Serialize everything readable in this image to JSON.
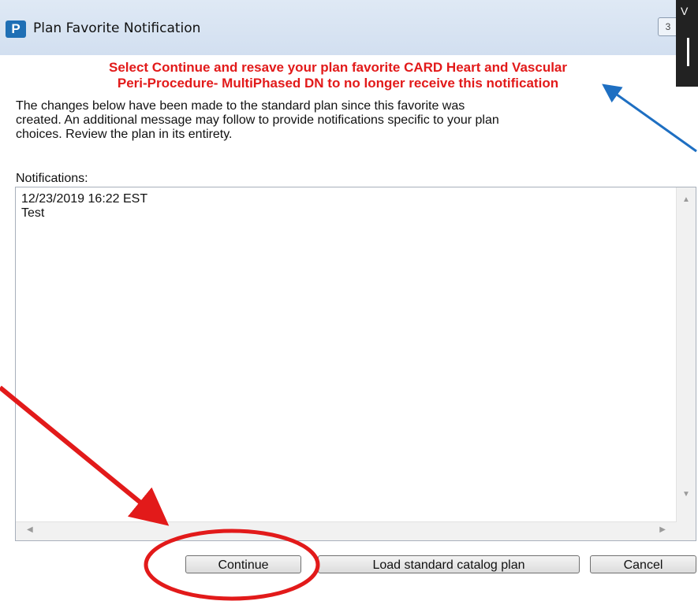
{
  "window": {
    "title": "Plan Favorite Notification",
    "icon_letter": "P",
    "titlebar_button_glyph": "3",
    "edge_glyph": "V"
  },
  "message": {
    "red_line_1": "Select Continue and resave your plan favorite CARD Heart and Vascular",
    "red_line_2": "Peri-Procedure- MultiPhased DN to no longer receive this notification",
    "description_line_1": "The changes below have been made to the standard plan since this favorite was",
    "description_line_2": "created. An additional message may follow to provide notifications specific to your plan",
    "description_line_3": "choices. Review the plan in its entirety."
  },
  "notifications": {
    "label": "Notifications:",
    "entry_timestamp": "12/23/2019 16:22 EST",
    "entry_text": "Test"
  },
  "buttons": {
    "continue": "Continue",
    "load_standard": "Load standard catalog plan",
    "cancel": "Cancel"
  },
  "annotation_colors": {
    "red": "#e21a1a",
    "blue": "#1e6fc2"
  }
}
